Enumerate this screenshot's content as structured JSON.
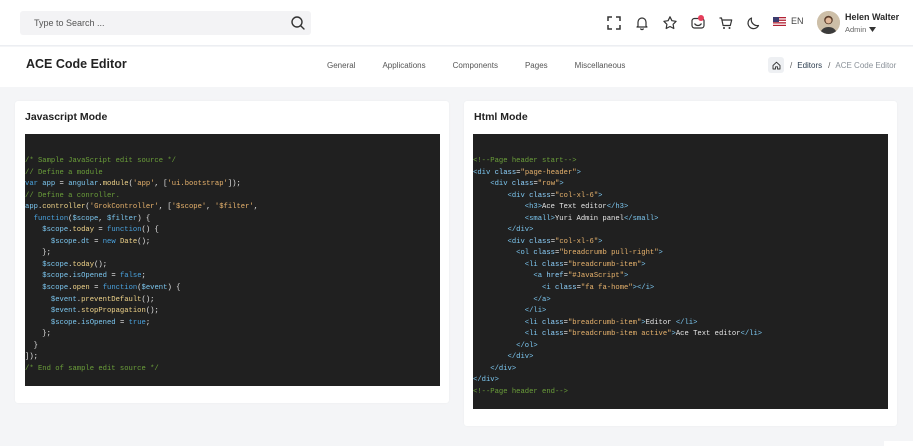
{
  "search": {
    "placeholder": "Type to Search ..."
  },
  "topbar": {
    "language": "EN",
    "user_name": "Helen Walter",
    "user_role": "Admin"
  },
  "page": {
    "title": "ACE Code Editor",
    "nav": [
      "General",
      "Applications",
      "Components",
      "Pages",
      "Miscellaneous"
    ],
    "breadcrumb": {
      "editors": "Editors",
      "current": "ACE Code Editor"
    }
  },
  "colors": {
    "accent": "#e53e5b",
    "editor_bg": "#202020",
    "page_bg": "#f4f5f7"
  },
  "js_card": {
    "title": "Javascript Mode",
    "lines": [
      [
        [
          "c",
          "/* Sample JavaScript edit source */"
        ]
      ],
      [
        [
          "c",
          "// Define a module"
        ]
      ],
      [
        [
          "k",
          "var"
        ],
        [
          "p",
          " "
        ],
        [
          "v",
          "app"
        ],
        [
          "p",
          " = "
        ],
        [
          "v",
          "angular"
        ],
        [
          "p",
          "."
        ],
        [
          "f",
          "module"
        ],
        [
          "p",
          "("
        ],
        [
          "s",
          "'app'"
        ],
        [
          "p",
          ", ["
        ],
        [
          "s",
          "'ui.bootstrap'"
        ],
        [
          "p",
          "]);"
        ]
      ],
      [
        [
          "c",
          "// Define a conroller."
        ]
      ],
      [
        [
          "v",
          "app"
        ],
        [
          "p",
          "."
        ],
        [
          "f",
          "controller"
        ],
        [
          "p",
          "("
        ],
        [
          "s",
          "'GrokController'"
        ],
        [
          "p",
          ", ["
        ],
        [
          "s",
          "'$scope'"
        ],
        [
          "p",
          ", "
        ],
        [
          "s",
          "'$filter'"
        ],
        [
          "p",
          ","
        ]
      ],
      [
        [
          "p",
          "  "
        ],
        [
          "k",
          "function"
        ],
        [
          "p",
          "("
        ],
        [
          "v",
          "$scope"
        ],
        [
          "p",
          ", "
        ],
        [
          "v",
          "$filter"
        ],
        [
          "p",
          ") {"
        ]
      ],
      [
        [
          "p",
          "    "
        ],
        [
          "v",
          "$scope"
        ],
        [
          "p",
          "."
        ],
        [
          "f",
          "today"
        ],
        [
          "p",
          " = "
        ],
        [
          "k",
          "function"
        ],
        [
          "p",
          "() {"
        ]
      ],
      [
        [
          "p",
          "      "
        ],
        [
          "v",
          "$scope"
        ],
        [
          "p",
          "."
        ],
        [
          "v",
          "dt"
        ],
        [
          "p",
          " = "
        ],
        [
          "k",
          "new"
        ],
        [
          "p",
          " "
        ],
        [
          "f",
          "Date"
        ],
        [
          "p",
          "();"
        ]
      ],
      [
        [
          "p",
          "    };"
        ]
      ],
      [
        [
          "p",
          "    "
        ],
        [
          "v",
          "$scope"
        ],
        [
          "p",
          "."
        ],
        [
          "f",
          "today"
        ],
        [
          "p",
          "();"
        ]
      ],
      [
        [
          "p",
          "    "
        ],
        [
          "v",
          "$scope"
        ],
        [
          "p",
          "."
        ],
        [
          "v",
          "isOpened"
        ],
        [
          "p",
          " = "
        ],
        [
          "k",
          "false"
        ],
        [
          "p",
          ";"
        ]
      ],
      [
        [
          "p",
          "    "
        ],
        [
          "v",
          "$scope"
        ],
        [
          "p",
          "."
        ],
        [
          "f",
          "open"
        ],
        [
          "p",
          " = "
        ],
        [
          "k",
          "function"
        ],
        [
          "p",
          "("
        ],
        [
          "v",
          "$event"
        ],
        [
          "p",
          ") {"
        ]
      ],
      [
        [
          "p",
          "      "
        ],
        [
          "v",
          "$event"
        ],
        [
          "p",
          "."
        ],
        [
          "f",
          "preventDefault"
        ],
        [
          "p",
          "();"
        ]
      ],
      [
        [
          "p",
          "      "
        ],
        [
          "v",
          "$event"
        ],
        [
          "p",
          "."
        ],
        [
          "f",
          "stopPropagation"
        ],
        [
          "p",
          "();"
        ]
      ],
      [
        [
          "p",
          "      "
        ],
        [
          "v",
          "$scope"
        ],
        [
          "p",
          "."
        ],
        [
          "v",
          "isOpened"
        ],
        [
          "p",
          " = "
        ],
        [
          "k",
          "true"
        ],
        [
          "p",
          ";"
        ]
      ],
      [
        [
          "p",
          "    };"
        ]
      ],
      [
        [
          "p",
          "  }"
        ]
      ],
      [
        [
          "p",
          "]);"
        ]
      ],
      [
        [
          "c",
          "/* End of sample edit source */"
        ]
      ]
    ]
  },
  "html_card": {
    "title": "Html Mode",
    "lines": [
      [
        [
          "c",
          "<!--Page header start-->"
        ]
      ],
      [
        [
          "t",
          "<div"
        ],
        [
          "p",
          " "
        ],
        [
          "a",
          "class"
        ],
        [
          "p",
          "="
        ],
        [
          "s",
          "\"page-header\""
        ],
        [
          "t",
          ">"
        ]
      ],
      [
        [
          "p",
          "    "
        ],
        [
          "t",
          "<div"
        ],
        [
          "p",
          " "
        ],
        [
          "a",
          "class"
        ],
        [
          "p",
          "="
        ],
        [
          "s",
          "\"row\""
        ],
        [
          "t",
          ">"
        ]
      ],
      [
        [
          "p",
          "        "
        ],
        [
          "t",
          "<div"
        ],
        [
          "p",
          " "
        ],
        [
          "a",
          "class"
        ],
        [
          "p",
          "="
        ],
        [
          "s",
          "\"col-xl-6\""
        ],
        [
          "t",
          ">"
        ]
      ],
      [
        [
          "p",
          "            "
        ],
        [
          "t",
          "<h3>"
        ],
        [
          "p",
          "Ace Text editor"
        ],
        [
          "t",
          "</h3>"
        ]
      ],
      [
        [
          "p",
          "            "
        ],
        [
          "t",
          "<small>"
        ],
        [
          "p",
          "Yuri Admin panel"
        ],
        [
          "t",
          "</small>"
        ]
      ],
      [
        [
          "p",
          "        "
        ],
        [
          "t",
          "</div>"
        ]
      ],
      [
        [
          "p",
          "        "
        ],
        [
          "t",
          "<div"
        ],
        [
          "p",
          " "
        ],
        [
          "a",
          "class"
        ],
        [
          "p",
          "="
        ],
        [
          "s",
          "\"col-xl-6\""
        ],
        [
          "t",
          ">"
        ]
      ],
      [
        [
          "p",
          "          "
        ],
        [
          "t",
          "<ol"
        ],
        [
          "p",
          " "
        ],
        [
          "a",
          "class"
        ],
        [
          "p",
          "="
        ],
        [
          "s",
          "\"breadcrumb pull-right\""
        ],
        [
          "t",
          ">"
        ]
      ],
      [
        [
          "p",
          "            "
        ],
        [
          "t",
          "<li"
        ],
        [
          "p",
          " "
        ],
        [
          "a",
          "class"
        ],
        [
          "p",
          "="
        ],
        [
          "s",
          "\"breadcrumb-item\""
        ],
        [
          "t",
          ">"
        ]
      ],
      [
        [
          "p",
          "              "
        ],
        [
          "t",
          "<a"
        ],
        [
          "p",
          " "
        ],
        [
          "a",
          "href"
        ],
        [
          "p",
          "="
        ],
        [
          "s",
          "\"#JavaScript\""
        ],
        [
          "t",
          ">"
        ]
      ],
      [
        [
          "p",
          "                "
        ],
        [
          "t",
          "<i"
        ],
        [
          "p",
          " "
        ],
        [
          "a",
          "class"
        ],
        [
          "p",
          "="
        ],
        [
          "s",
          "\"fa fa-home\""
        ],
        [
          "t",
          "></i>"
        ]
      ],
      [
        [
          "p",
          "              "
        ],
        [
          "t",
          "</a>"
        ]
      ],
      [
        [
          "p",
          "            "
        ],
        [
          "t",
          "</li>"
        ]
      ],
      [
        [
          "p",
          "            "
        ],
        [
          "t",
          "<li"
        ],
        [
          "p",
          " "
        ],
        [
          "a",
          "class"
        ],
        [
          "p",
          "="
        ],
        [
          "s",
          "\"breadcrumb-item\""
        ],
        [
          "t",
          ">"
        ],
        [
          "p",
          "Editor "
        ],
        [
          "t",
          "</li>"
        ]
      ],
      [
        [
          "p",
          "            "
        ],
        [
          "t",
          "<li"
        ],
        [
          "p",
          " "
        ],
        [
          "a",
          "class"
        ],
        [
          "p",
          "="
        ],
        [
          "s",
          "\"breadcrumb-item active\""
        ],
        [
          "t",
          ">"
        ],
        [
          "p",
          "Ace Text editor"
        ],
        [
          "t",
          "</li>"
        ]
      ],
      [
        [
          "p",
          "          "
        ],
        [
          "t",
          "</ol>"
        ]
      ],
      [
        [
          "p",
          "        "
        ],
        [
          "t",
          "</div>"
        ]
      ],
      [
        [
          "p",
          "    "
        ],
        [
          "t",
          "</div>"
        ]
      ],
      [
        [
          "t",
          "</div>"
        ]
      ],
      [
        [
          "c",
          "<!--Page header end-->"
        ]
      ]
    ]
  }
}
